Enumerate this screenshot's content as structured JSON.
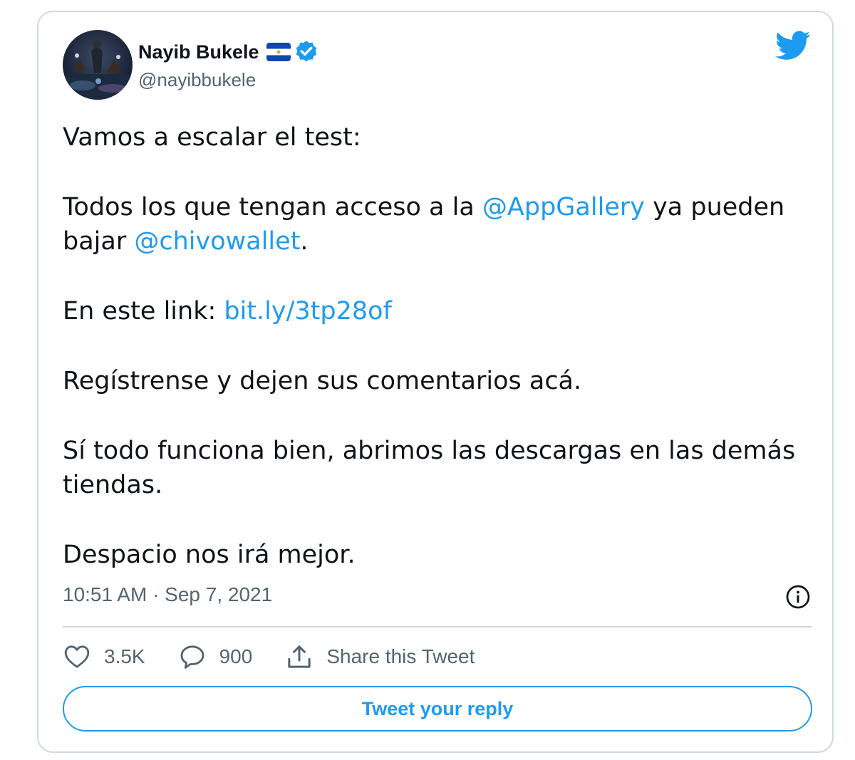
{
  "author": {
    "display_name": "Nayib Bukele",
    "handle": "@nayibbukele",
    "flag": "el-salvador-flag-icon",
    "verified": "verified-badge-icon"
  },
  "tweet": {
    "line1": "Vamos a escalar el test:",
    "p2_before": "Todos los que tengan acceso a la ",
    "p2_mention1": "@AppGallery",
    "p2_middle": " ya pueden bajar ",
    "p2_mention2": "@chivowallet",
    "p2_after": ".",
    "p3_before": "En este link: ",
    "p3_link": "bit.ly/3tp28of",
    "p4": "Regístrense y dejen sus comentarios acá.",
    "p5": "Sí todo funciona bien, abrimos las descargas en las demás tiendas.",
    "p6": "Despacio nos irá mejor."
  },
  "timestamp": "10:51 AM · Sep 7, 2021",
  "actions": {
    "likes": "3.5K",
    "replies": "900",
    "share_label": "Share this Tweet"
  },
  "reply_button_label": "Tweet your reply",
  "icons": {
    "brand": "twitter-bird-icon",
    "info": "info-icon",
    "like": "heart-icon",
    "reply": "speech-bubble-icon",
    "share": "share-icon"
  },
  "colors": {
    "accent": "#1d9bf0",
    "text": "#0f1419",
    "secondary": "#536471",
    "border": "#cfd9de"
  }
}
